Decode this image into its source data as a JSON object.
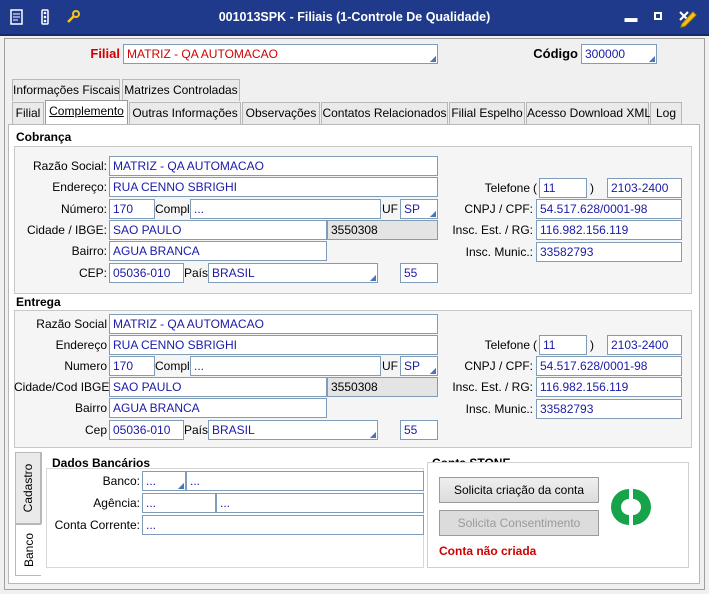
{
  "window": {
    "title": "001013SPK - Filiais (1-Controle De Qualidade)",
    "icons": [
      "doc-icon",
      "traffic-light-icon",
      "wrench-icon"
    ],
    "controls": {
      "menu": "▬",
      "minimize": "▪",
      "maximize": "□",
      "edit": "✎"
    }
  },
  "header": {
    "filial_label": "Filial",
    "filial_value": "MATRIZ - QA AUTOMACAO",
    "codigo_label": "Código",
    "codigo_value": "300000"
  },
  "tabs_row1": [
    "Informações Fiscais",
    "Matrizes Controladas"
  ],
  "tabs_row2": [
    {
      "text": "Filial",
      "active": false
    },
    {
      "text": "Complemento",
      "active": true
    },
    {
      "text": "Outras Informações",
      "active": false
    },
    {
      "text": "Observações",
      "active": false
    },
    {
      "text": "Contatos Relacionados",
      "active": false
    },
    {
      "text": "Filial Espelho",
      "active": false
    },
    {
      "text": "Acesso Download XML",
      "active": false
    },
    {
      "text": "Log",
      "active": false
    }
  ],
  "cobranca": {
    "title": "Cobrança",
    "labels": {
      "razao": "Razão Social:",
      "endereco": "Endereço:",
      "numero": "Número:",
      "compl": "Compl.:",
      "uf": "UF",
      "cidade": "Cidade / IBGE:",
      "bairro": "Bairro:",
      "cep": "CEP:",
      "pais": "País",
      "telefone": "Telefone",
      "cnpj": "CNPJ / CPF:",
      "insc_est": "Insc. Est. / RG:",
      "insc_munic": "Insc. Munic.:"
    },
    "values": {
      "razao": "MATRIZ - QA AUTOMACAO",
      "endereco": "RUA CENNO SBRIGHI",
      "numero": "170",
      "compl": "...",
      "uf": "SP",
      "cidade": "SAO PAULO",
      "ibge": "3550308",
      "bairro": "AGUA BRANCA",
      "cep": "05036-010",
      "pais": "BRASIL",
      "pais_code": "55",
      "ddd": "11",
      "telefone": "2103-2400",
      "cnpj": "54.517.628/0001-98",
      "insc_est": "116.982.156.119",
      "insc_munic": "33582793"
    }
  },
  "entrega": {
    "title": "Entrega",
    "labels": {
      "razao": "Razão Social",
      "endereco": "Endereço",
      "numero": "Numero",
      "compl": "Compl.",
      "uf": "UF",
      "cidade": "Cidade/Cod IBGE",
      "bairro": "Bairro",
      "cep": "Cep",
      "pais": "País",
      "telefone": "Telefone",
      "cnpj": "CNPJ / CPF:",
      "insc_est": "Insc. Est. / RG:",
      "insc_munic": "Insc. Munic.:"
    },
    "values": {
      "razao": "MATRIZ - QA AUTOMACAO",
      "endereco": "RUA CENNO SBRIGHI",
      "numero": "170",
      "compl": "...",
      "uf": "SP",
      "cidade": "SAO PAULO",
      "ibge": "3550308",
      "bairro": "AGUA BRANCA",
      "cep": "05036-010",
      "pais": "BRASIL",
      "pais_code": "55",
      "ddd": "11",
      "telefone": "2103-2400",
      "cnpj": "54.517.628/0001-98",
      "insc_est": "116.982.156.119",
      "insc_munic": "33582793"
    }
  },
  "side_tabs": [
    {
      "text": "Cadastro",
      "active": false
    },
    {
      "text": "Banco",
      "active": true
    }
  ],
  "bancarios": {
    "title": "Dados Bancários",
    "banco_label": "Banco:",
    "banco_code": "...",
    "banco_name": "...",
    "agencia_label": "Agência:",
    "agencia_code": "...",
    "agencia_name": "...",
    "conta_label": "Conta Corrente:",
    "conta_value": "..."
  },
  "stone": {
    "title": "Conta STONE",
    "create_button": "Solicita criação da conta",
    "consent_button": "Solicita Consentimento",
    "status": "Conta não criada",
    "status_color": "#d00000",
    "logo_color": "#16a34a"
  }
}
